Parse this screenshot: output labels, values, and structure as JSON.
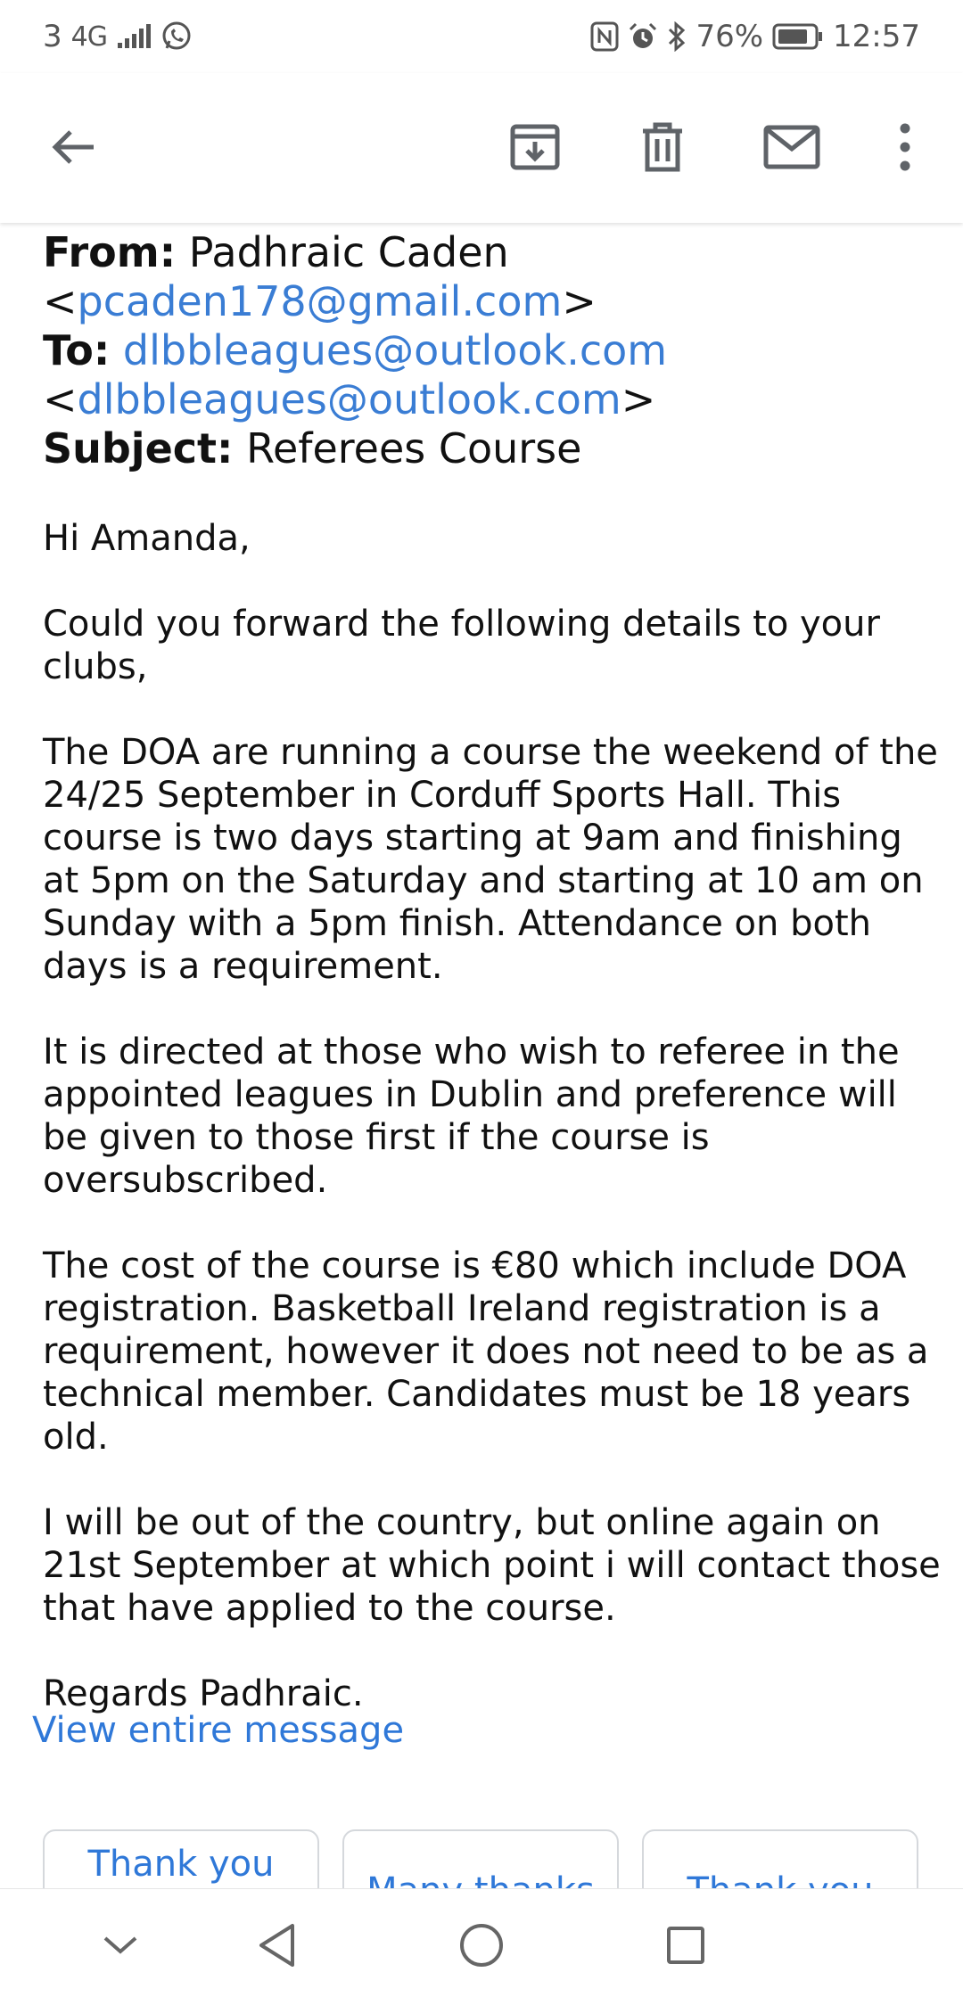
{
  "status_bar": {
    "sim": "3",
    "network": "4G",
    "battery": "76%",
    "time": "12:57"
  },
  "toolbar": {
    "icons": [
      "back-arrow-icon",
      "archive-icon",
      "delete-icon",
      "mail-icon",
      "more-vert-icon"
    ]
  },
  "message": {
    "from_label": "From:",
    "from_name": "Padhraic Caden",
    "from_email": "pcaden178@gmail.com",
    "to_label": "To:",
    "to_name": "dlbbleagues@outlook.com",
    "to_email": "dlbbleagues@outlook.com",
    "subject_label": "Subject:",
    "subject": "Referees Course",
    "greeting": "Hi Amanda,",
    "paragraphs": [
      "Could you forward the following details to your clubs,",
      "The DOA are running a course the weekend of the 24/25 September in Corduff Sports Hall. This course is two days starting at 9am and finishing at 5pm on the Saturday and starting at 10 am on Sunday with a 5pm finish. Attendance on both days is a requirement.",
      "It is directed at those who wish to referee in the appointed leagues in Dublin and preference will be given to those first if the course is oversubscribed.",
      "The cost of the course is €80 which include DOA registration. Basketball Ireland registration is a requirement, however it does not need to be as a technical member. Candidates must be 18 years old.",
      "I will be out of the country, but online again on 21st September at which point i will contact those that have applied to the course."
    ],
    "signoff": "Regards Padhraic.",
    "view_entire": "View entire message"
  },
  "smart_replies": [
    "Thank you",
    "Many thanks",
    "Thank you"
  ],
  "accent_color": "#3a7dd4",
  "nav_icons": [
    "chevron-down-icon",
    "nav-back-icon",
    "nav-home-icon",
    "nav-recent-icon"
  ]
}
